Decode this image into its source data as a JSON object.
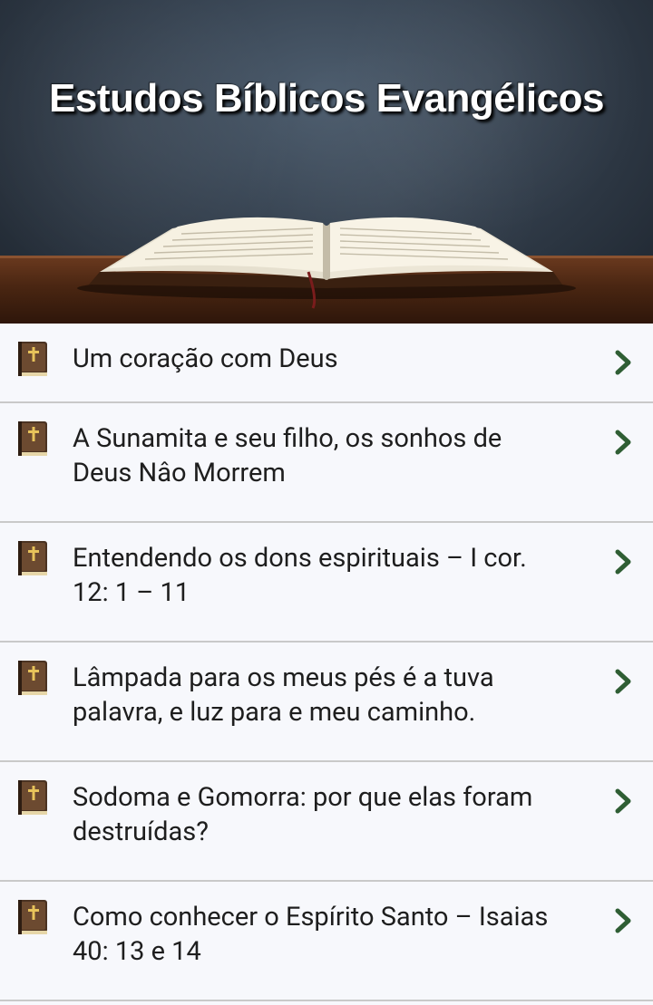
{
  "banner": {
    "title": "Estudos Bíblicos Evangélicos"
  },
  "items": [
    {
      "label": "Um coração com Deus"
    },
    {
      "label": "A Sunamita e seu filho, os sonhos de Deus Nâo Morrem"
    },
    {
      "label": "Entendendo os dons espirituais – I cor. 12: 1 – 11"
    },
    {
      "label": "Lâmpada para os meus pés é a tuva palavra, e luz para e meu caminho."
    },
    {
      "label": "Sodoma e Gomorra: por que elas foram destruídas?"
    },
    {
      "label": "Como conhecer o Espírito Santo – Isaias 40: 13 e 14"
    }
  ],
  "icons": {
    "item_icon": "bible-icon",
    "chevron": "chevron-right-icon"
  },
  "colors": {
    "chevron": "#2f5e34",
    "divider": "#c9c9c9",
    "background": "#f7f8fc"
  }
}
